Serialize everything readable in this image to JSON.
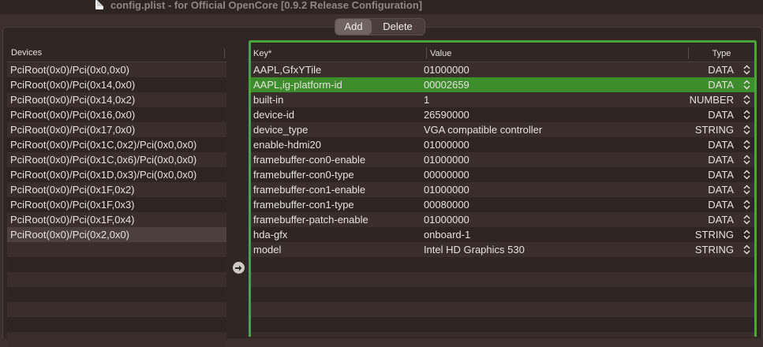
{
  "window": {
    "title": "config.plist - for Official OpenCore [0.9.2 Release Configuration]"
  },
  "toolbar": {
    "add_label": "Add",
    "delete_label": "Delete"
  },
  "devices": {
    "header": "Devices",
    "items": [
      "PciRoot(0x0)/Pci(0x0,0x0)",
      "PciRoot(0x0)/Pci(0x14,0x0)",
      "PciRoot(0x0)/Pci(0x14,0x2)",
      "PciRoot(0x0)/Pci(0x16,0x0)",
      "PciRoot(0x0)/Pci(0x17,0x0)",
      "PciRoot(0x0)/Pci(0x1C,0x2)/Pci(0x0,0x0)",
      "PciRoot(0x0)/Pci(0x1C,0x6)/Pci(0x0,0x0)",
      "PciRoot(0x0)/Pci(0x1D,0x3)/Pci(0x0,0x0)",
      "PciRoot(0x0)/Pci(0x1F,0x2)",
      "PciRoot(0x0)/Pci(0x1F,0x3)",
      "PciRoot(0x0)/Pci(0x1F,0x4)",
      "PciRoot(0x0)/Pci(0x2,0x0)"
    ],
    "selected_index": 11
  },
  "properties": {
    "headers": {
      "key": "Key*",
      "value": "Value",
      "type": "Type"
    },
    "rows": [
      {
        "key": "AAPL,GfxYTile",
        "value": "01000000",
        "type": "DATA"
      },
      {
        "key": "AAPL,ig-platform-id",
        "value": "00002659",
        "type": "DATA"
      },
      {
        "key": "built-in",
        "value": "1",
        "type": "NUMBER"
      },
      {
        "key": "device-id",
        "value": "26590000",
        "type": "DATA"
      },
      {
        "key": "device_type",
        "value": "VGA compatible controller",
        "type": "STRING"
      },
      {
        "key": "enable-hdmi20",
        "value": "01000000",
        "type": "DATA"
      },
      {
        "key": "framebuffer-con0-enable",
        "value": "01000000",
        "type": "DATA"
      },
      {
        "key": "framebuffer-con0-type",
        "value": "00000000",
        "type": "DATA"
      },
      {
        "key": "framebuffer-con1-enable",
        "value": "01000000",
        "type": "DATA"
      },
      {
        "key": "framebuffer-con1-type",
        "value": "00080000",
        "type": "DATA"
      },
      {
        "key": "framebuffer-patch-enable",
        "value": "01000000",
        "type": "DATA"
      },
      {
        "key": "hda-gfx",
        "value": "onboard-1",
        "type": "STRING"
      },
      {
        "key": "model",
        "value": "Intel HD Graphics 530",
        "type": "STRING"
      }
    ],
    "highlighted_index": 1
  },
  "colors": {
    "accent": "#3e8d2c",
    "focus_ring": "#4aa63b",
    "background": "#3b302c"
  },
  "icons": {
    "title": "document-icon",
    "move": "arrow-right-circle-icon",
    "type_select": "chevron-updown-icon"
  }
}
